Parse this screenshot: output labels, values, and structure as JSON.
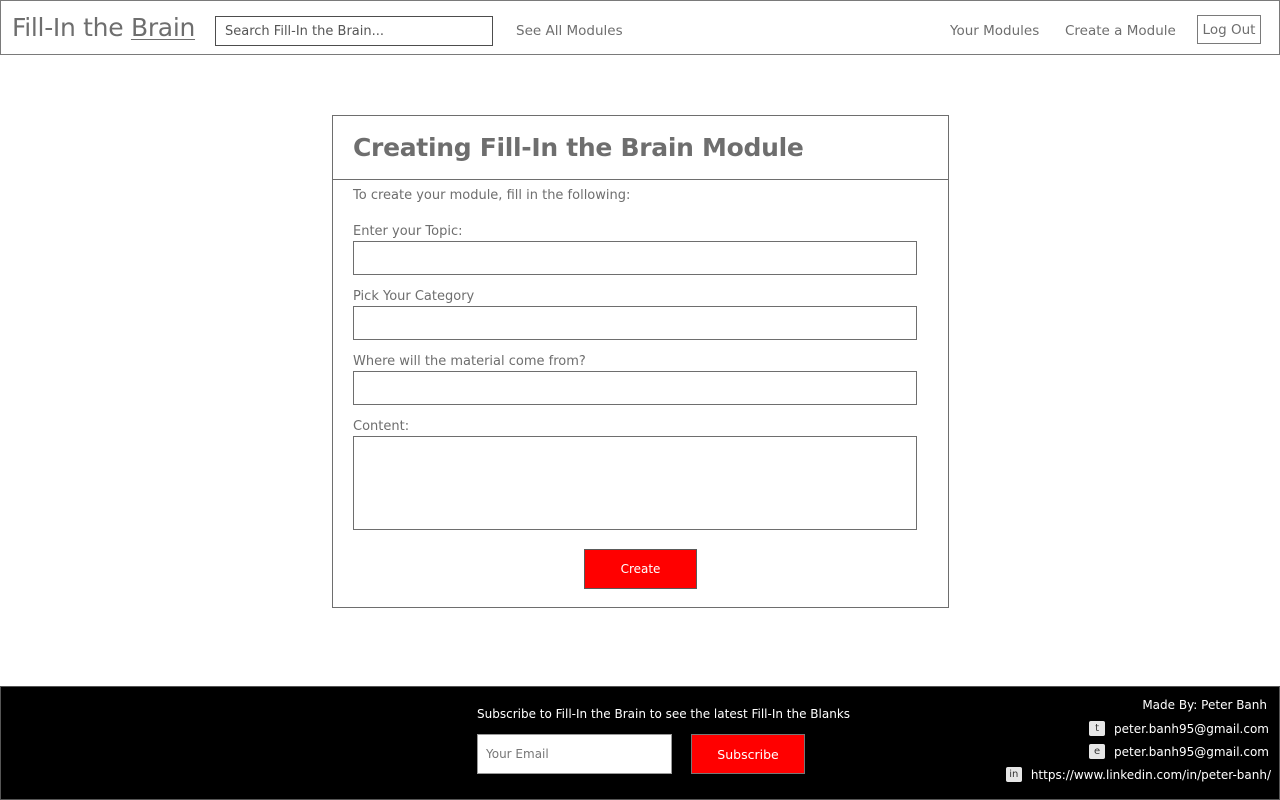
{
  "header": {
    "logo_prefix": "Fill-In the ",
    "logo_emphasis": "Brain",
    "search_placeholder": "Search Fill-In the Brain...",
    "nav": {
      "see_all": "See All Modules",
      "your_modules": "Your Modules",
      "create_module": "Create a Module",
      "logout": "Log Out"
    }
  },
  "form": {
    "title": "Creating Fill-In the Brain Module",
    "intro": "To create your module, fill in the following:",
    "fields": {
      "topic_label": "Enter your Topic:",
      "category_label": "Pick Your Category",
      "source_label": "Where will the material come from?",
      "content_label": "Content:"
    },
    "submit_label": "Create",
    "submit_color": "#ff0000"
  },
  "footer": {
    "subscribe_text": "Subscribe to Fill-In the Brain to see the latest Fill-In the Blanks",
    "email_placeholder": "Your Email",
    "subscribe_label": "Subscribe",
    "made_by": "Made By: Peter Banh",
    "contacts": {
      "twitter": {
        "icon": "t",
        "text": "peter.banh95@gmail.com"
      },
      "email": {
        "icon": "e",
        "text": "peter.banh95@gmail.com"
      },
      "linkedin": {
        "icon": "in",
        "text": "https://www.linkedin.com/in/peter-banh/"
      }
    }
  }
}
